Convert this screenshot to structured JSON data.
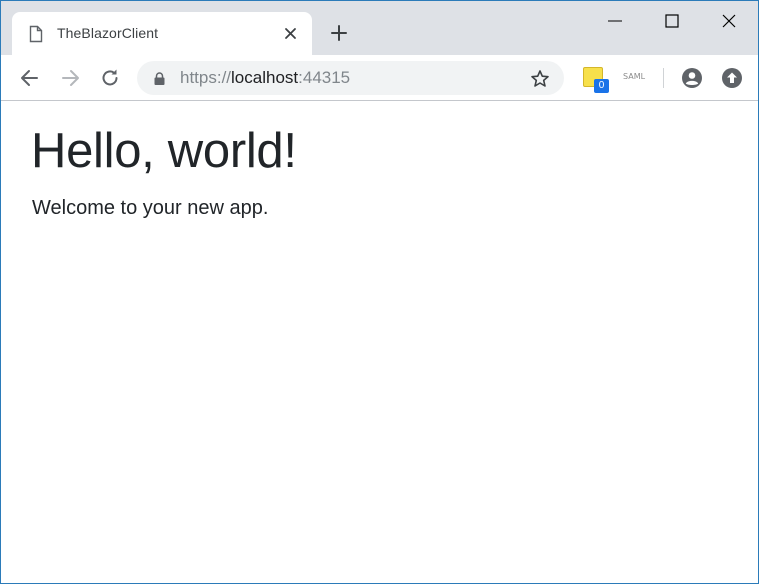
{
  "browser": {
    "tab": {
      "title": "TheBlazorClient",
      "icon": "document-icon"
    },
    "window_controls": [
      "minimize",
      "maximize",
      "close"
    ],
    "address_bar": {
      "scheme": "https://",
      "host": "localhost",
      "port": ":44315"
    },
    "extensions": {
      "notes_badge": "0",
      "saml_label": "SAML"
    }
  },
  "page": {
    "heading": "Hello, world!",
    "text": "Welcome to your new app."
  },
  "colors": {
    "tabstrip": "#dee1e6",
    "omnibox": "#f1f3f4",
    "text": "#212529",
    "window_border": "#2b7bb9"
  }
}
